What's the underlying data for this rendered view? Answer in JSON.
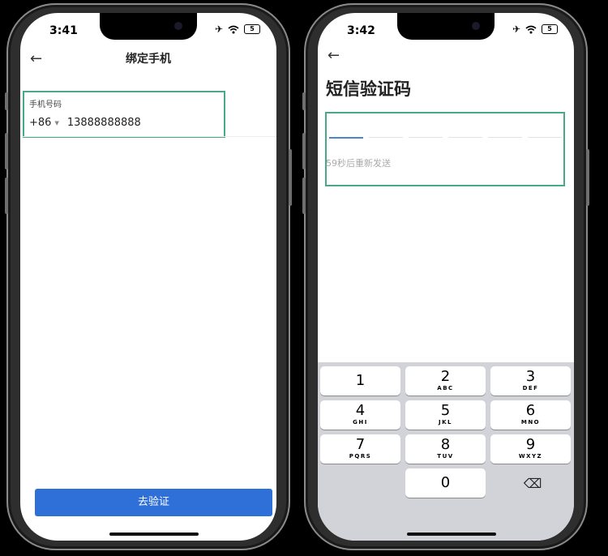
{
  "screen1": {
    "status_time": "3:41",
    "battery": "5",
    "back_icon": "←",
    "title": "绑定手机",
    "phone_label": "手机号码",
    "country_code": "+86",
    "caret": "▼",
    "phone_value": "13888888888",
    "submit_label": "去验证"
  },
  "screen2": {
    "status_time": "3:42",
    "battery": "5",
    "back_icon": "←",
    "title": "短信验证码",
    "resend_text": "59秒后重新发送",
    "keys": [
      {
        "num": "1",
        "letters": ""
      },
      {
        "num": "2",
        "letters": "ABC"
      },
      {
        "num": "3",
        "letters": "DEF"
      },
      {
        "num": "4",
        "letters": "GHI"
      },
      {
        "num": "5",
        "letters": "JKL"
      },
      {
        "num": "6",
        "letters": "MNO"
      },
      {
        "num": "7",
        "letters": "PQRS"
      },
      {
        "num": "8",
        "letters": "TUV"
      },
      {
        "num": "9",
        "letters": "WXYZ"
      },
      {
        "num": "0",
        "letters": ""
      }
    ],
    "backspace_icon": "⌫"
  },
  "colors": {
    "highlight": "#4aa88a",
    "primary_button": "#2f6fd8",
    "active_slot": "#4a86c8"
  },
  "icons": [
    "airplane-icon",
    "wifi-icon",
    "battery-icon",
    "back-arrow-icon",
    "backspace-icon"
  ]
}
